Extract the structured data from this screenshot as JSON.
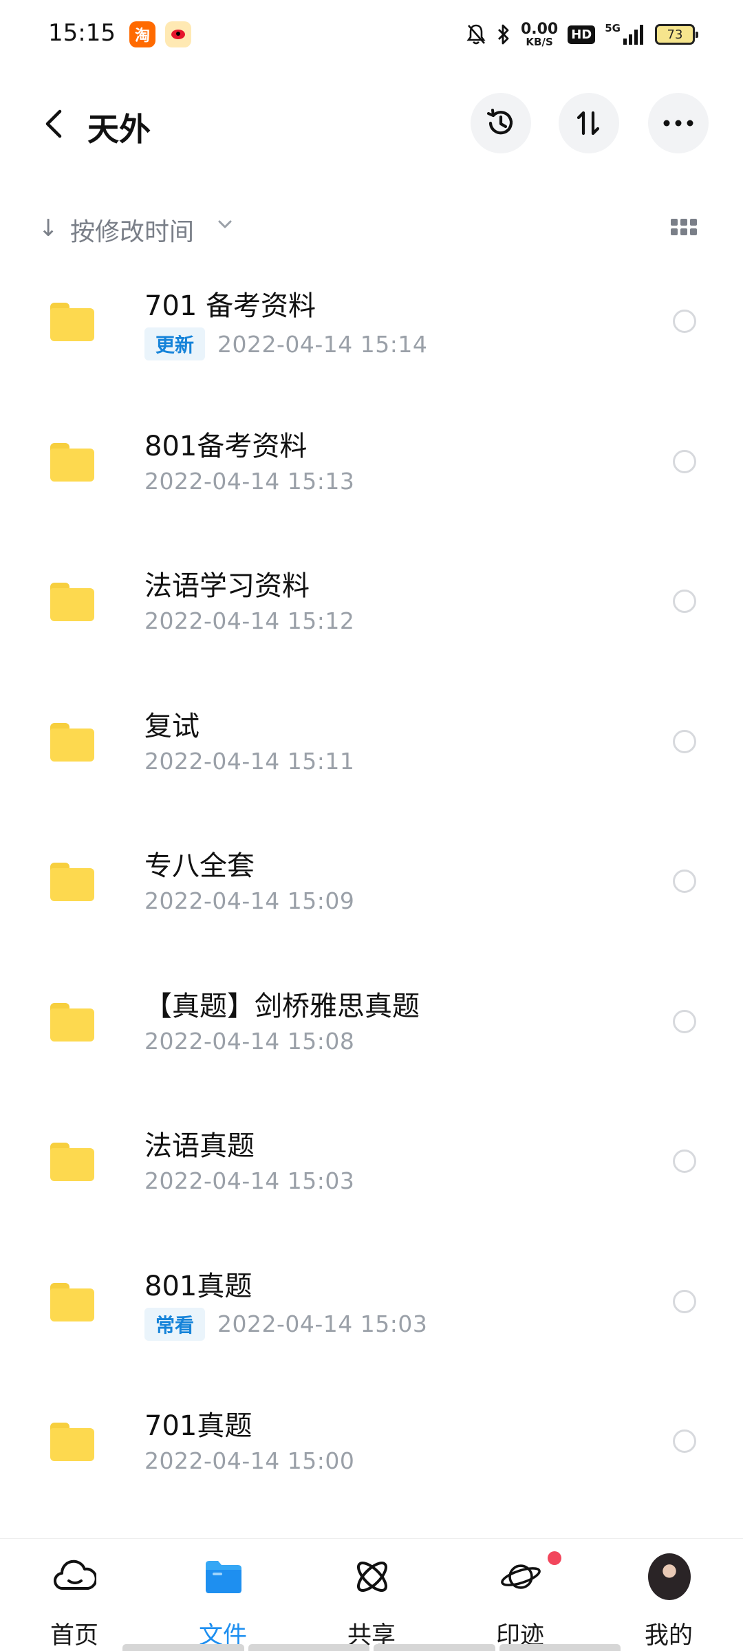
{
  "status_bar": {
    "time": "15:15",
    "app_icons": [
      "淘",
      "weibo"
    ],
    "net_speed_value": "0.00",
    "net_speed_unit": "KB/S",
    "hd": "HD",
    "network": "5G",
    "battery": "73"
  },
  "header": {
    "title": "天外",
    "icons": [
      "back-arrow-icon",
      "history-icon",
      "sort-icon",
      "more-icon"
    ]
  },
  "sort": {
    "label": "按修改时间"
  },
  "files": [
    {
      "name": "701 备考资料",
      "tag": "更新",
      "date": "2022-04-14  15:14"
    },
    {
      "name": "801备考资料",
      "tag": "",
      "date": "2022-04-14  15:13"
    },
    {
      "name": "法语学习资料",
      "tag": "",
      "date": "2022-04-14  15:12"
    },
    {
      "name": "复试",
      "tag": "",
      "date": "2022-04-14  15:11"
    },
    {
      "name": "专八全套",
      "tag": "",
      "date": "2022-04-14  15:09"
    },
    {
      "name": "【真题】剑桥雅思真题",
      "tag": "",
      "date": "2022-04-14  15:08"
    },
    {
      "name": "法语真题",
      "tag": "",
      "date": "2022-04-14  15:03"
    },
    {
      "name": "801真题",
      "tag": "常看",
      "date": "2022-04-14  15:03"
    },
    {
      "name": "701真题",
      "tag": "",
      "date": "2022-04-14  15:00"
    }
  ],
  "bottom_nav": {
    "items": [
      {
        "label": "首页",
        "icon": "cloud-icon"
      },
      {
        "label": "文件",
        "icon": "folder-icon"
      },
      {
        "label": "共享",
        "icon": "atom-icon"
      },
      {
        "label": "印迹",
        "icon": "planet-icon"
      },
      {
        "label": "我的",
        "icon": "avatar"
      }
    ],
    "active_index": 1
  },
  "colors": {
    "accent": "#1e8ff0",
    "folder": "#fdd94f",
    "tag_text": "#1583d9",
    "tag_bg": "#eaf4fb",
    "notify": "#f2465c"
  }
}
